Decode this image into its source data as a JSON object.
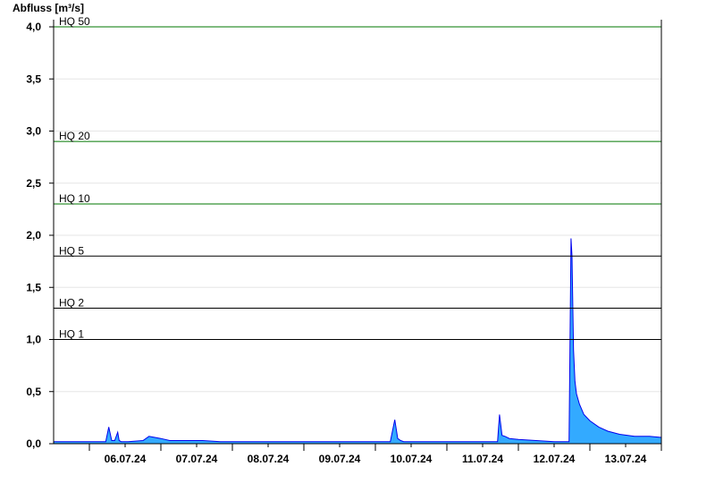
{
  "chart_data": {
    "type": "area",
    "ylabel": "Abfluss [m³/s]",
    "xlabel": "",
    "ylim": [
      0,
      4.05
    ],
    "xlim": [
      "05.07.24 12:00",
      "13.07.24 24:00"
    ],
    "yticks": [
      "0,0",
      "0,5",
      "1,0",
      "1,5",
      "2,0",
      "2,5",
      "3,0",
      "3,5",
      "4,0"
    ],
    "ytick_values": [
      0,
      0.5,
      1.0,
      1.5,
      2.0,
      2.5,
      3.0,
      3.5,
      4.0
    ],
    "xticks": [
      "06.07.24",
      "07.07.24",
      "08.07.24",
      "09.07.24",
      "10.07.24",
      "11.07.24",
      "12.07.24",
      "13.07.24"
    ],
    "xtick_days": [
      6,
      7,
      8,
      9,
      10,
      11,
      12,
      13
    ],
    "grid": true,
    "fill_color": "#33aaff",
    "line_color": "#0000ee",
    "reference_lines": [
      {
        "label": "HQ 1",
        "value": 1.0,
        "color": "#000000"
      },
      {
        "label": "HQ 2",
        "value": 1.3,
        "color": "#000000"
      },
      {
        "label": "HQ 5",
        "value": 1.8,
        "color": "#000000"
      },
      {
        "label": "HQ 10",
        "value": 2.3,
        "color": "#007700"
      },
      {
        "label": "HQ 20",
        "value": 2.9,
        "color": "#007700"
      },
      {
        "label": "HQ 50",
        "value": 4.0,
        "color": "#007700"
      }
    ],
    "series": [
      {
        "x": [
          "05.07.24 12:00",
          "06.07.24 03:00",
          "06.07.24 05:30",
          "06.07.24 06:30",
          "06.07.24 07:30",
          "06.07.24 08:30",
          "06.07.24 09:30",
          "06.07.24 10:00",
          "06.07.24 10:40",
          "06.07.24 11:30",
          "06.07.24 13:00",
          "06.07.24 18:00",
          "06.07.24 20:00",
          "06.07.24 22:00",
          "06.07.24 24:00",
          "07.07.24 03:00",
          "07.07.24 07:00",
          "07.07.24 10:00",
          "07.07.24 14:00",
          "07.07.24 20:00",
          "08.07.24 06:00",
          "08.07.24 18:00",
          "09.07.24 06:00",
          "09.07.24 18:00",
          "10.07.24 00:00",
          "10.07.24 03:00",
          "10.07.24 05:00",
          "10.07.24 06:30",
          "10.07.24 07:30",
          "10.07.24 08:30",
          "10.07.24 09:30",
          "10.07.24 11:00",
          "10.07.24 14:00",
          "10.07.24 18:00",
          "11.07.24 06:00",
          "11.07.24 12:00",
          "11.07.24 17:00",
          "11.07.24 17:40",
          "11.07.24 18:30",
          "11.07.24 19:30",
          "11.07.24 21:00",
          "11.07.24 24:00",
          "12.07.24 06:00",
          "12.07.24 12:00",
          "12.07.24 16:00",
          "12.07.24 17:00",
          "12.07.24 17:40",
          "12.07.24 18:00",
          "12.07.24 18:30",
          "12.07.24 19:00",
          "12.07.24 19:30",
          "12.07.24 20:30",
          "12.07.24 22:00",
          "12.07.24 24:00",
          "13.07.24 03:00",
          "13.07.24 06:00",
          "13.07.24 10:00",
          "13.07.24 15:00",
          "13.07.24 20:00",
          "13.07.24 24:00"
        ],
        "y": [
          0.02,
          0.02,
          0.02,
          0.16,
          0.03,
          0.03,
          0.11,
          0.03,
          0.02,
          0.02,
          0.02,
          0.03,
          0.07,
          0.06,
          0.05,
          0.03,
          0.03,
          0.03,
          0.03,
          0.02,
          0.02,
          0.02,
          0.02,
          0.02,
          0.02,
          0.02,
          0.02,
          0.23,
          0.05,
          0.03,
          0.02,
          0.02,
          0.02,
          0.02,
          0.02,
          0.02,
          0.02,
          0.28,
          0.08,
          0.07,
          0.05,
          0.04,
          0.03,
          0.02,
          0.02,
          0.02,
          1.97,
          1.8,
          0.9,
          0.6,
          0.48,
          0.38,
          0.28,
          0.22,
          0.16,
          0.12,
          0.09,
          0.07,
          0.07,
          0.06
        ]
      }
    ]
  }
}
